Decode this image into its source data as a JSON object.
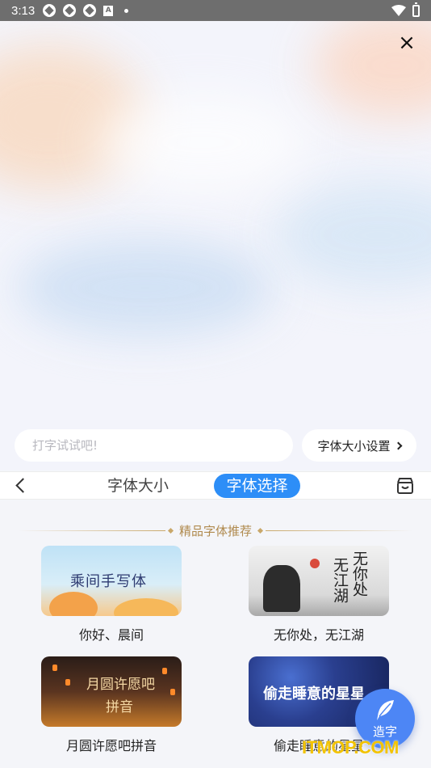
{
  "status_bar": {
    "time": "3:13",
    "notif_a": "A"
  },
  "preview": {
    "close_icon": "×"
  },
  "try_input": {
    "placeholder": "打字试试吧!"
  },
  "size_settings": {
    "label": "字体大小设置"
  },
  "tabs": {
    "items": [
      {
        "label": "字体大小"
      },
      {
        "label": "字体选择",
        "active": true
      }
    ]
  },
  "section": {
    "title": "精品字体推荐"
  },
  "fonts": [
    {
      "caption": "你好、晨间",
      "thumb_text": "乘间手写体"
    },
    {
      "caption": "无你处，无江湖",
      "thumb_lines": [
        "无你处",
        "无江湖"
      ]
    },
    {
      "caption": "月圆许愿吧拼音",
      "thumb_lines": [
        "月圆许愿吧",
        "拼音"
      ]
    },
    {
      "caption": "偷走睡意的星星",
      "thumb_text": "偷走睡意的星星"
    }
  ],
  "fab": {
    "label": "造字"
  },
  "watermark": {
    "text": "ITMOP.COM"
  },
  "colors": {
    "accent": "#2d8ef7",
    "fab": "#4d86f5",
    "gold": "#b08a4e"
  }
}
